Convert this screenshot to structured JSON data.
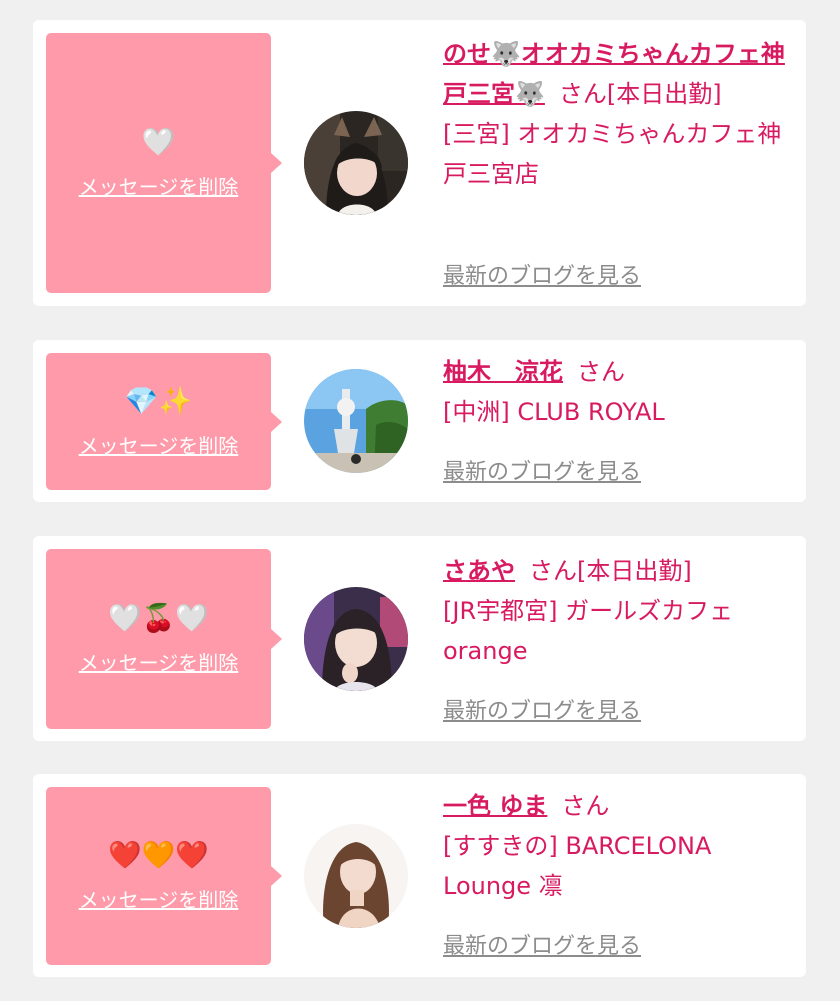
{
  "cards": [
    {
      "name": "のせ🐺オオカミちゃんカフェ神戸三宮🐺",
      "honorific": "さん",
      "status": "[本日出勤]",
      "shop": "[三宮] オオカミちゃんカフェ神戸三宮店",
      "message_emoji": "🤍",
      "delete_label": "メッセージを削除",
      "blog_label": "最新のブログを見る"
    },
    {
      "name": "柚木　涼花",
      "honorific": "さん",
      "status": "",
      "shop": "[中洲] CLUB ROYAL",
      "message_emoji": "💎✨",
      "delete_label": "メッセージを削除",
      "blog_label": "最新のブログを見る"
    },
    {
      "name": "さあや",
      "honorific": "さん",
      "status": "[本日出勤]",
      "shop": "[JR宇都宮] ガールズカフェorange",
      "message_emoji": "🤍🍒🤍",
      "delete_label": "メッセージを削除",
      "blog_label": "最新のブログを見る"
    },
    {
      "name": "一色 ゆま",
      "honorific": "さん",
      "status": "",
      "shop": "[すすきの] BARCELONA Lounge 凛",
      "message_emoji": "❤️🧡❤️",
      "delete_label": "メッセージを削除",
      "blog_label": "最新のブログを見る"
    }
  ],
  "colors": {
    "page_background": "#f0f0f0",
    "card_background": "#ffffff",
    "bubble_pink": "#fe9aa9",
    "name_pink": "#d81b60",
    "blog_gray": "#8c8c8c"
  }
}
